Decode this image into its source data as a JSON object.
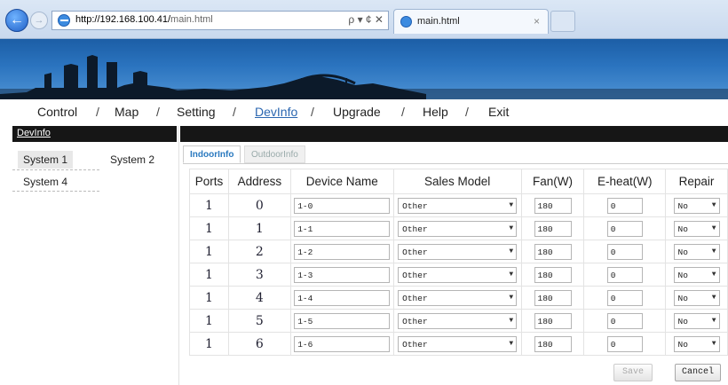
{
  "browser": {
    "url_host": "http://192.168.100.41/",
    "url_path": "main.html",
    "addr_tools": "ρ ▾ ¢ ✕",
    "tab_title": "main.html",
    "tab_close": "×"
  },
  "menu": {
    "items": [
      "Control",
      "Map",
      "Setting",
      "DevInfo",
      "Upgrade",
      "Help",
      "Exit"
    ],
    "separator": "/",
    "active": "DevInfo"
  },
  "sidebar": {
    "title": "DevInfo",
    "systems": [
      "System 1",
      "System 2",
      "System 4"
    ],
    "selected": "System 1"
  },
  "subtabs": [
    "IndoorInfo",
    "OutdoorInfo"
  ],
  "table": {
    "headers": [
      "Ports",
      "Address",
      "Device Name",
      "Sales Model",
      "Fan(W)",
      "E-heat(W)",
      "Repair"
    ],
    "rows": [
      {
        "port": "1",
        "address": "0",
        "name": "1-0",
        "model": "Other",
        "fan": "180",
        "eheat": "0",
        "repair": "No"
      },
      {
        "port": "1",
        "address": "1",
        "name": "1-1",
        "model": "Other",
        "fan": "180",
        "eheat": "0",
        "repair": "No"
      },
      {
        "port": "1",
        "address": "2",
        "name": "1-2",
        "model": "Other",
        "fan": "180",
        "eheat": "0",
        "repair": "No"
      },
      {
        "port": "1",
        "address": "3",
        "name": "1-3",
        "model": "Other",
        "fan": "180",
        "eheat": "0",
        "repair": "No"
      },
      {
        "port": "1",
        "address": "4",
        "name": "1-4",
        "model": "Other",
        "fan": "180",
        "eheat": "0",
        "repair": "No"
      },
      {
        "port": "1",
        "address": "5",
        "name": "1-5",
        "model": "Other",
        "fan": "180",
        "eheat": "0",
        "repair": "No"
      },
      {
        "port": "1",
        "address": "6",
        "name": "1-6",
        "model": "Other",
        "fan": "180",
        "eheat": "0",
        "repair": "No"
      }
    ]
  },
  "buttons": {
    "save": "Save",
    "cancel": "Cancel"
  },
  "colors": {
    "accent": "#2a66b0",
    "banner": "#2b74bf",
    "title_bar": "#161616"
  }
}
